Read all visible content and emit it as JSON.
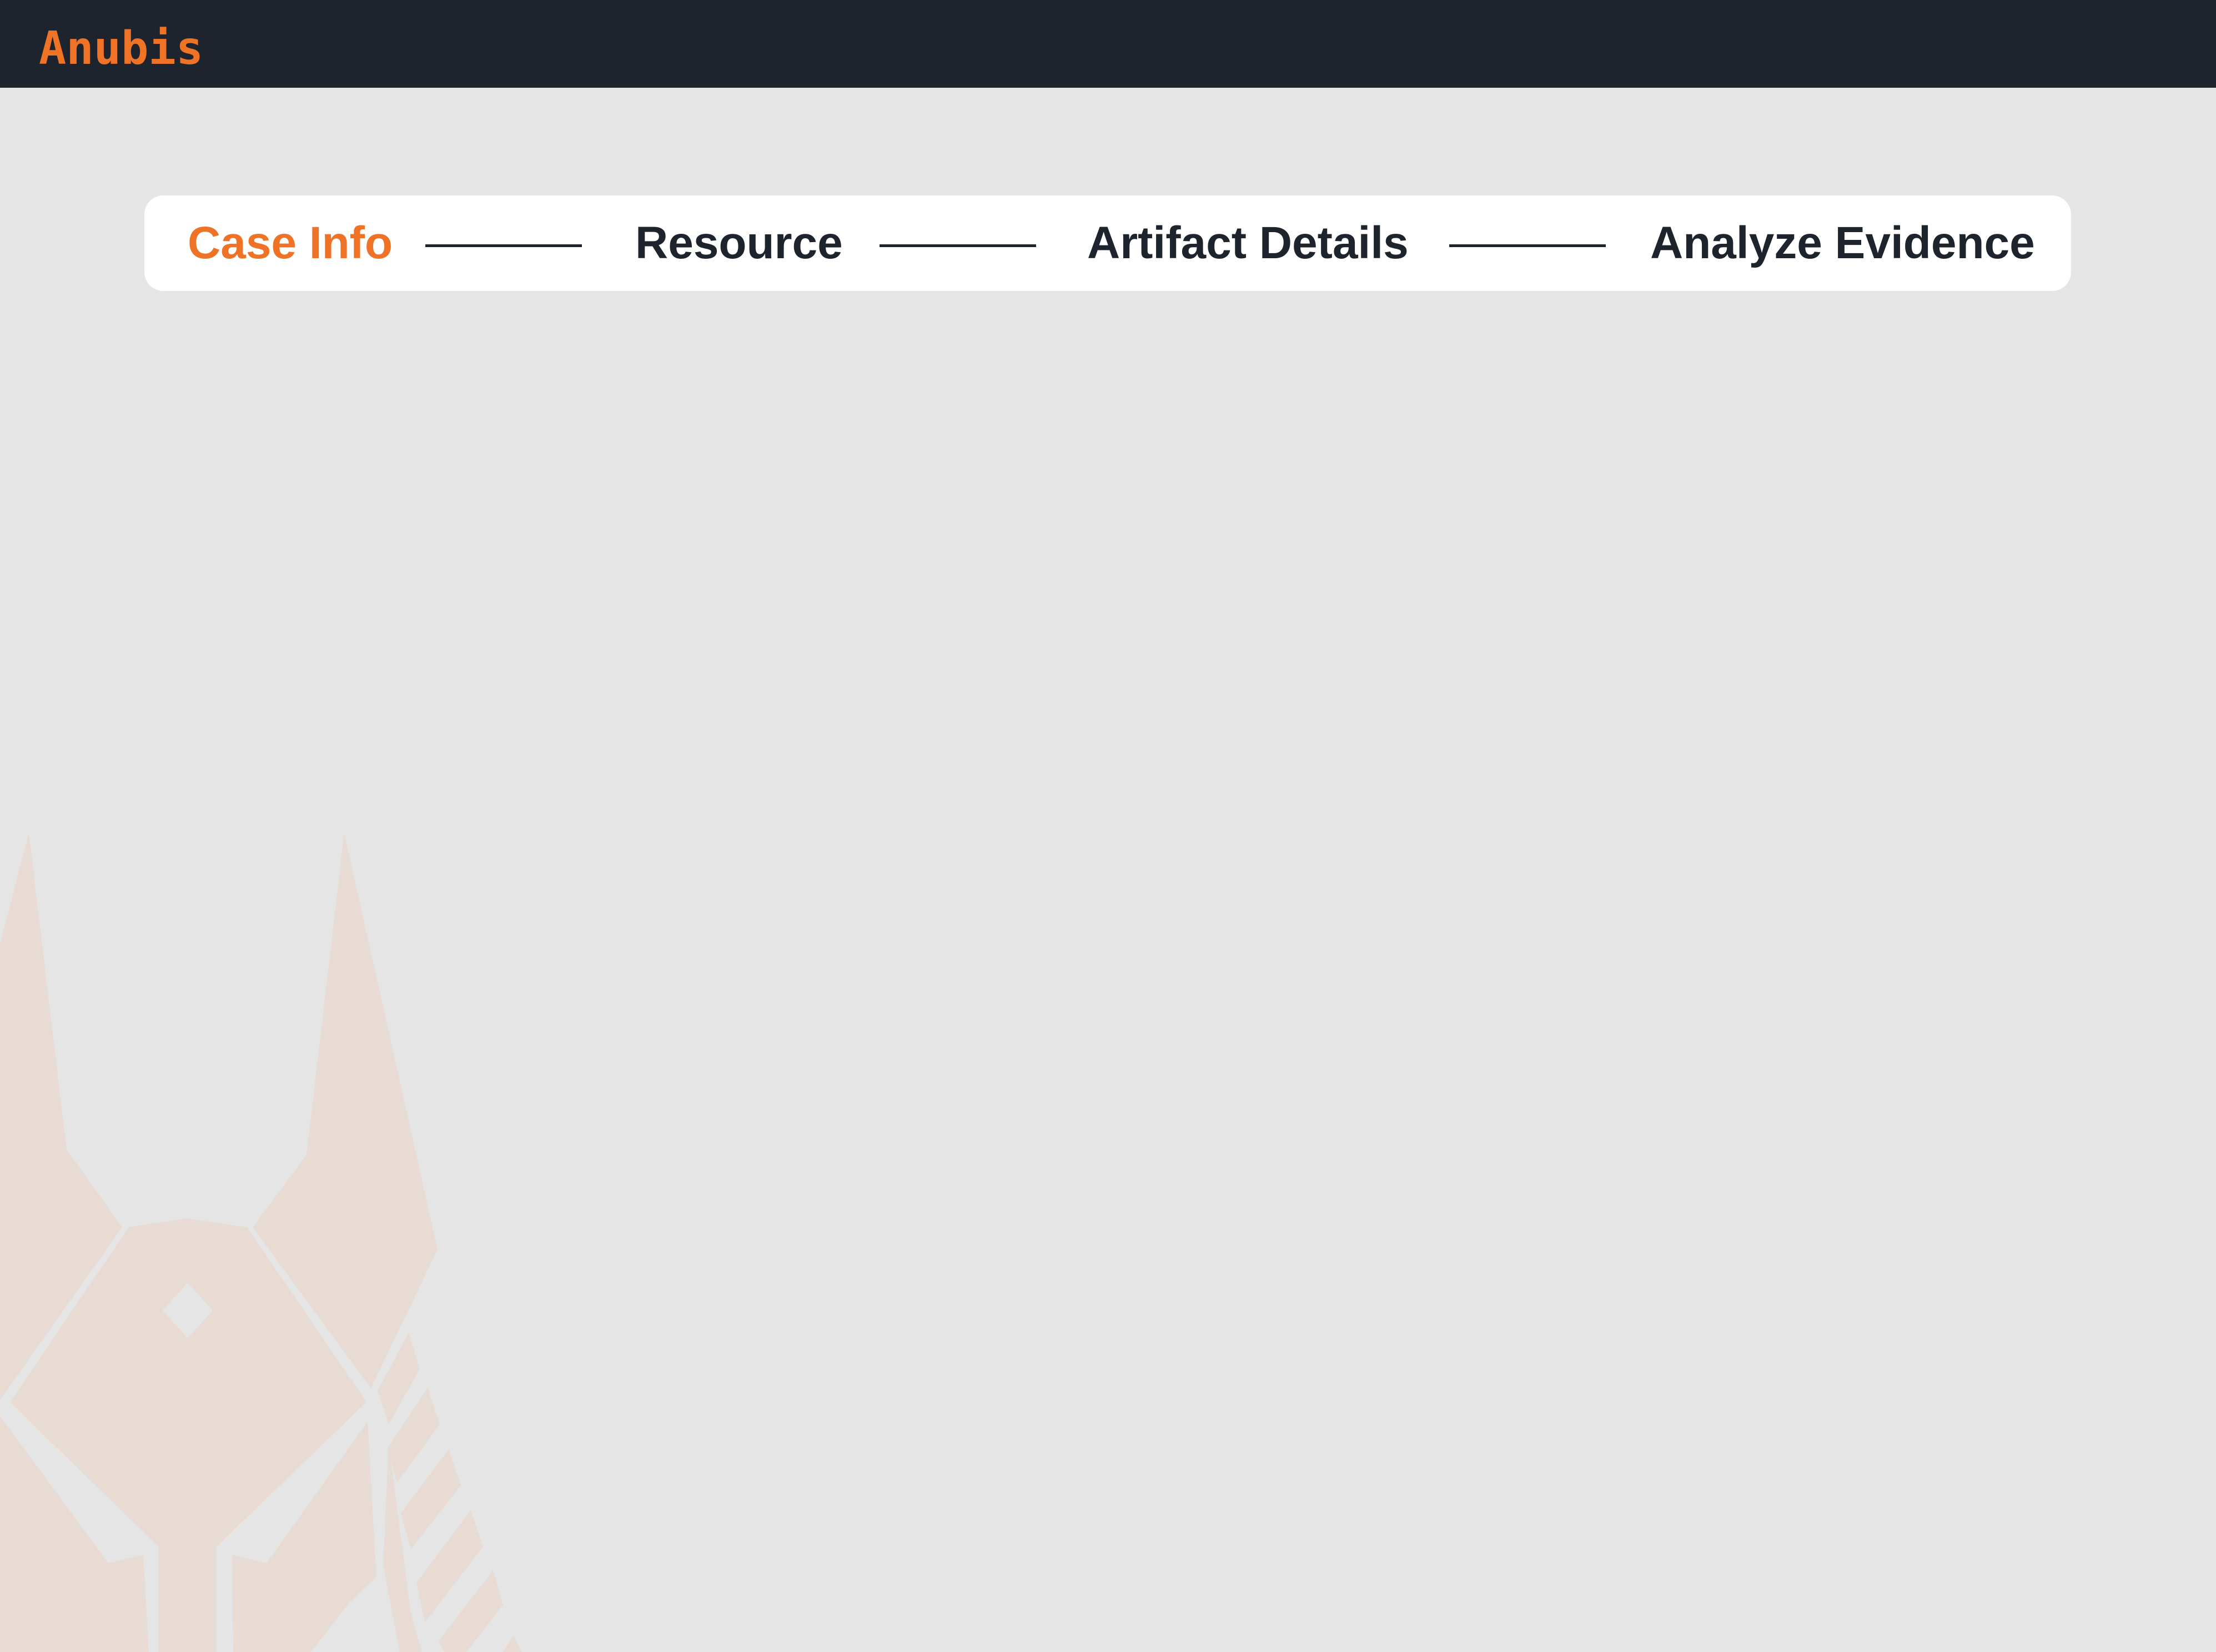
{
  "app": {
    "brand": "Anubis",
    "brand_color": "#ee7326",
    "header_bg": "#1e242d"
  },
  "stepper": {
    "steps": [
      {
        "label": "Case Info",
        "active": true
      },
      {
        "label": "Resource",
        "active": false
      },
      {
        "label": "Artifact Details",
        "active": false
      },
      {
        "label": "Analyze Evidence",
        "active": false
      }
    ],
    "active_color": "#ee7326",
    "inactive_color": "#1e242d"
  },
  "decoration": {
    "watermark": "anubis-logo-icon",
    "watermark_color": "#e8dbd3"
  }
}
